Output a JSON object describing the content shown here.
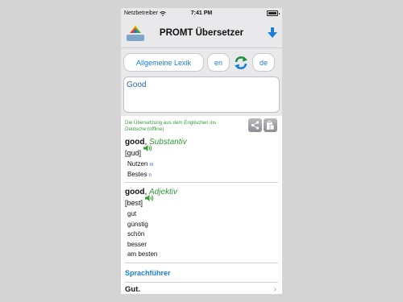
{
  "status_bar": {
    "carrier": "Netzbetreiber",
    "time": "7:41 PM"
  },
  "nav": {
    "title": "PROMT Übersetzer",
    "logo_icon": "promt-logo-icon",
    "download_icon": "arrow-down-icon"
  },
  "controls": {
    "dictionary": "Allgemeine Lexik",
    "source_lang": "en",
    "target_lang": "de",
    "swap_icon": "swap-arrows-icon"
  },
  "input": {
    "value": "Good"
  },
  "result": {
    "note": "Die Übersetzung aus dem Englischen ins Deutsche (offline)",
    "share_icon": "share-icon",
    "copy_icon": "copy-icon",
    "entries": [
      {
        "word": "good",
        "pos": "Substantiv",
        "pronunciation": "[gud]",
        "translations": [
          {
            "text": "Nutzen",
            "gender": "m"
          },
          {
            "text": "Bestes",
            "gender": "n"
          }
        ]
      },
      {
        "word": "good",
        "pos": "Adjektiv",
        "pronunciation": "[best]",
        "translations": [
          {
            "text": "gut"
          },
          {
            "text": "günstig"
          },
          {
            "text": "schön"
          },
          {
            "text": "besser"
          },
          {
            "text": "am besten"
          }
        ]
      }
    ],
    "phrasebook": {
      "header": "Sprachführer",
      "items": [
        "Gut."
      ]
    }
  },
  "colors": {
    "accent": "#1a7fd8",
    "pos_green": "#2f9a3c",
    "input_text": "#2b5fad"
  }
}
